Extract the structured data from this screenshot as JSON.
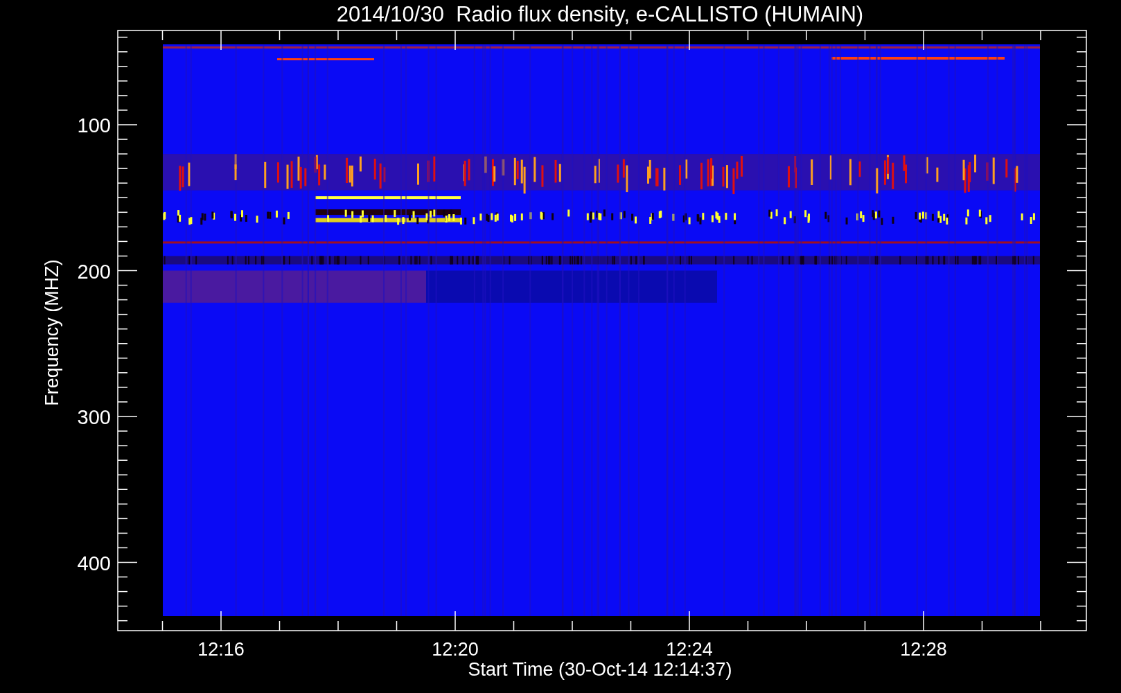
{
  "title": "2014/10/30  Radio flux density, e-CALLISTO (HUMAIN)",
  "y_axis": {
    "label": "Frequency (MHZ)",
    "ticks": [
      "100",
      "200",
      "300",
      "400"
    ]
  },
  "x_axis": {
    "label": "Start Time (30-Oct-14 12:14:37)",
    "ticks": [
      "12:16",
      "12:20",
      "12:24",
      "12:28"
    ]
  }
}
